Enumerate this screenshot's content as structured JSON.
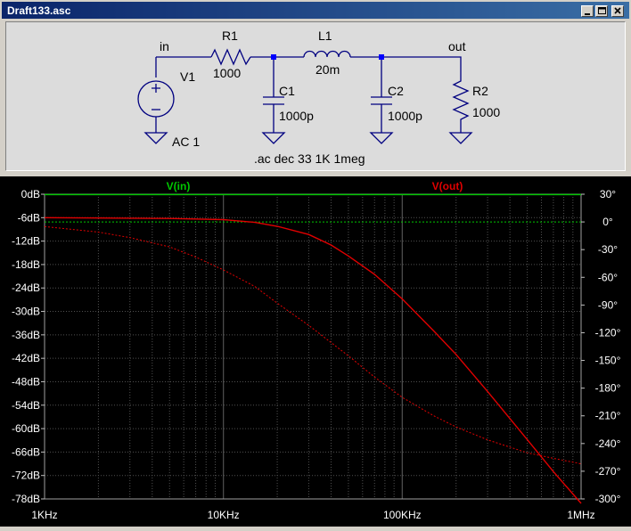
{
  "window": {
    "title": "Draft133.asc"
  },
  "colors": {
    "wire": "#000080",
    "component": "#000080",
    "node": "#0000ff",
    "plot_bg": "#000000",
    "grid": "#505050",
    "axis_text": "#ffffff",
    "vin": "#00c800",
    "vout": "#e00000"
  },
  "schematic": {
    "net_in": "in",
    "net_out": "out",
    "v1": {
      "name": "V1",
      "value": "AC 1"
    },
    "r1": {
      "name": "R1",
      "value": "1000"
    },
    "l1": {
      "name": "L1",
      "value": "20m"
    },
    "c1": {
      "name": "C1",
      "value": "1000p"
    },
    "c2": {
      "name": "C2",
      "value": "1000p"
    },
    "r2": {
      "name": "R2",
      "value": "1000"
    },
    "directive": ".ac dec 33 1K 1meg"
  },
  "chart_data": {
    "type": "line",
    "x_scale": "log",
    "x_range": [
      1000,
      1000000
    ],
    "x_ticks": [
      "1KHz",
      "10KHz",
      "100KHz",
      "1MHz"
    ],
    "y_range_db": [
      -78,
      0
    ],
    "y_ticks_left": [
      "0dB",
      "-6dB",
      "-12dB",
      "-18dB",
      "-24dB",
      "-30dB",
      "-36dB",
      "-42dB",
      "-48dB",
      "-54dB",
      "-60dB",
      "-66dB",
      "-72dB",
      "-78dB"
    ],
    "y_range_deg": [
      -300,
      30
    ],
    "y_ticks_right": [
      "30°",
      "0°",
      "-30°",
      "-60°",
      "-90°",
      "-120°",
      "-150°",
      "-180°",
      "-210°",
      "-240°",
      "-270°",
      "-300°"
    ],
    "grid": true,
    "series": [
      {
        "name": "V(in)",
        "mag_db": [
          [
            1000,
            -0.1
          ],
          [
            1000000,
            -0.1
          ]
        ],
        "phase_deg": [
          [
            1000,
            0
          ],
          [
            1000000,
            0
          ]
        ]
      },
      {
        "name": "V(out)",
        "mag_db": [
          [
            1000,
            -6.0
          ],
          [
            2000,
            -6.1
          ],
          [
            5000,
            -6.2
          ],
          [
            10000,
            -6.5
          ],
          [
            15000,
            -7.2
          ],
          [
            20000,
            -8.2
          ],
          [
            30000,
            -10.3
          ],
          [
            40000,
            -13
          ],
          [
            50000,
            -15.8
          ],
          [
            70000,
            -20.5
          ],
          [
            100000,
            -26.8
          ],
          [
            150000,
            -35
          ],
          [
            200000,
            -41
          ],
          [
            300000,
            -50.5
          ],
          [
            500000,
            -62.8
          ],
          [
            700000,
            -71
          ],
          [
            1000000,
            -79.5
          ]
        ],
        "phase_deg": [
          [
            1000,
            -5
          ],
          [
            2000,
            -11
          ],
          [
            3000,
            -17
          ],
          [
            5000,
            -27
          ],
          [
            7000,
            -38
          ],
          [
            10000,
            -52
          ],
          [
            15000,
            -70
          ],
          [
            20000,
            -88
          ],
          [
            30000,
            -112
          ],
          [
            50000,
            -145
          ],
          [
            70000,
            -168
          ],
          [
            100000,
            -190
          ],
          [
            150000,
            -210
          ],
          [
            200000,
            -222
          ],
          [
            300000,
            -236
          ],
          [
            500000,
            -250
          ],
          [
            700000,
            -256
          ],
          [
            1000000,
            -262
          ]
        ]
      }
    ]
  }
}
